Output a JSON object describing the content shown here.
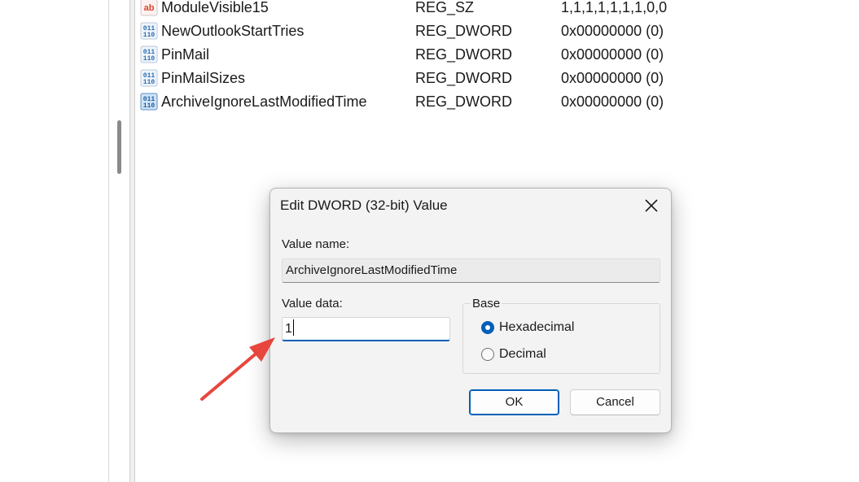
{
  "registry_values": [
    {
      "name": "ModuleVisible15",
      "type": "REG_SZ",
      "data": "1,1,1,1,1,1,1,0,0",
      "icon": "string-value-icon"
    },
    {
      "name": "NewOutlookStartTries",
      "type": "REG_DWORD",
      "data": "0x00000000 (0)",
      "icon": "binary-value-icon"
    },
    {
      "name": "PinMail",
      "type": "REG_DWORD",
      "data": "0x00000000 (0)",
      "icon": "binary-value-icon"
    },
    {
      "name": "PinMailSizes",
      "type": "REG_DWORD",
      "data": "0x00000000 (0)",
      "icon": "binary-value-icon"
    },
    {
      "name": "ArchiveIgnoreLastModifiedTime",
      "type": "REG_DWORD",
      "data": "0x00000000 (0)",
      "icon": "binary-value-icon"
    }
  ],
  "dialog": {
    "title": "Edit DWORD (32-bit) Value",
    "value_name_label": "Value name:",
    "value_name": "ArchiveIgnoreLastModifiedTime",
    "value_data_label": "Value data:",
    "value_data": "1",
    "base_label": "Base",
    "base_options": [
      {
        "label": "Hexadecimal",
        "checked": true
      },
      {
        "label": "Decimal",
        "checked": false
      }
    ],
    "ok_label": "OK",
    "cancel_label": "Cancel"
  },
  "colors": {
    "accent": "#005fb8",
    "annotation_arrow": "#e8453c",
    "string_icon": "#d9442e",
    "binary_icon": "#2b6cb0"
  }
}
